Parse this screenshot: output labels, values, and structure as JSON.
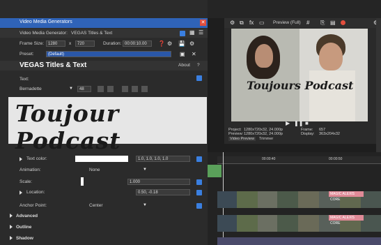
{
  "dialog": {
    "title": "Video Media Generators",
    "generator_label": "Video Media Generator:",
    "generator_value": "VEGAS Titles & Text",
    "frame_size_label": "Frame Size:",
    "width": "1280",
    "x_sep": "x",
    "height": "720",
    "duration_label": "Duration:",
    "duration": "00:00:10.00",
    "preset_label": "Preset:",
    "preset_value": "(Default)",
    "plugin_title": "VEGAS Titles & Text",
    "about": "About",
    "help": "?",
    "text_label": "Text:",
    "font_name": "Bernadette",
    "font_size": "48",
    "preview_text": "Toujour Podcast",
    "text_color_label": "Text color:",
    "text_color_value": "1.0, 1.0, 1.0, 1.0",
    "animation_label": "Animation:",
    "animation_value": "None",
    "scale_label": "Scale:",
    "scale_value": "1.000",
    "location_label": "Location:",
    "location_value": "0.50, -0.18",
    "anchor_label": "Anchor Point:",
    "anchor_value": "Center",
    "sections": [
      "Advanced",
      "Outline",
      "Shadow"
    ]
  },
  "preview_panel": {
    "toolbar_label": "Preview (Full)",
    "video_title": "Toujours Podcast",
    "project_label": "Project:",
    "project_value": "1280x720x32, 24.000p",
    "preview_label": "Preview:",
    "preview_value": "1280x720x32, 24.000p",
    "frame_label": "Frame:",
    "frame_value": "657",
    "display_label": "Display:",
    "display_value": "363x204x32",
    "tab_video_preview": "Video Preview",
    "tab_trimmer": "Trimmer"
  },
  "timeline": {
    "time_marks": [
      "00:00:40",
      "00:00:50"
    ],
    "clip_label": "MAGIC ALEXIS CORE"
  },
  "colors": {
    "title_bar": "#2f63b8",
    "accent_blue": "#3a7fe0",
    "close_red": "#e24e3d",
    "clip_pink": "#e08a97",
    "timeline_green": "#5aa05a"
  },
  "icons": [
    "close-icon",
    "play-icon",
    "pause-icon",
    "stop-icon",
    "settings-icon",
    "gear-icon",
    "save-icon"
  ]
}
